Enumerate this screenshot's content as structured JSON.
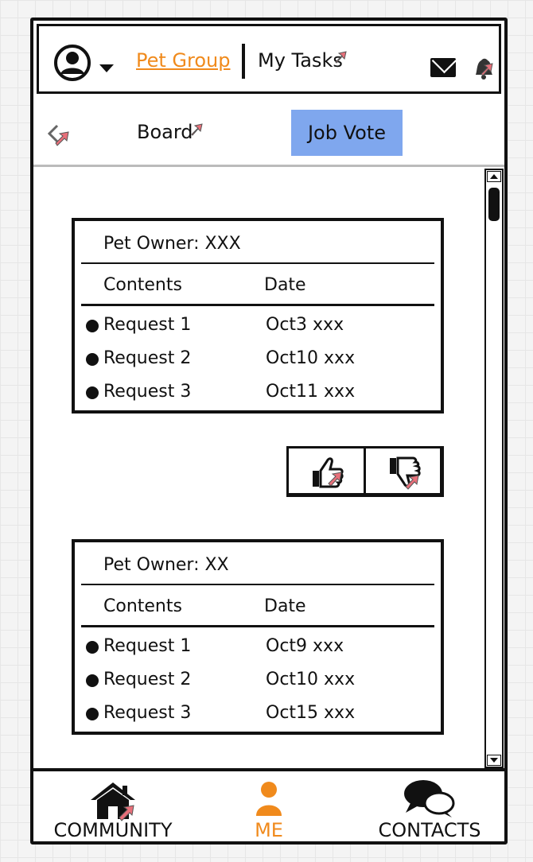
{
  "header": {
    "tab_pet_group": "Pet Group",
    "tab_my_tasks": "My Tasks"
  },
  "subnav": {
    "board_label": "Board",
    "job_vote_label": "Job Vote"
  },
  "cards": [
    {
      "owner": "Pet Owner: XXX",
      "col_contents": "Contents",
      "col_date": "Date",
      "rows": [
        {
          "request": "Request 1",
          "date": "Oct3 xxx"
        },
        {
          "request": "Request 2",
          "date": "Oct10 xxx"
        },
        {
          "request": "Request 3",
          "date": "Oct11 xxx"
        }
      ]
    },
    {
      "owner": "Pet Owner: XX",
      "col_contents": "Contents",
      "col_date": "Date",
      "rows": [
        {
          "request": "Request 1",
          "date": "Oct9 xxx"
        },
        {
          "request": "Request 2",
          "date": "Oct10 xxx"
        },
        {
          "request": "Request 3",
          "date": "Oct15 xxx"
        }
      ]
    }
  ],
  "bottom_nav": {
    "community": "COMMUNITY",
    "me": "ME",
    "contacts": "CONTACTS"
  },
  "colors": {
    "accent": "#f08a1c",
    "selected_tab": "#7fa7ee",
    "link_marker": "#e8707a"
  },
  "icons": [
    "user-avatar-icon",
    "chevron-down-icon",
    "mail-icon",
    "bell-icon",
    "back-arrow-icon",
    "thumbs-up-icon",
    "thumbs-down-icon",
    "home-icon",
    "person-icon",
    "chat-bubbles-icon"
  ]
}
